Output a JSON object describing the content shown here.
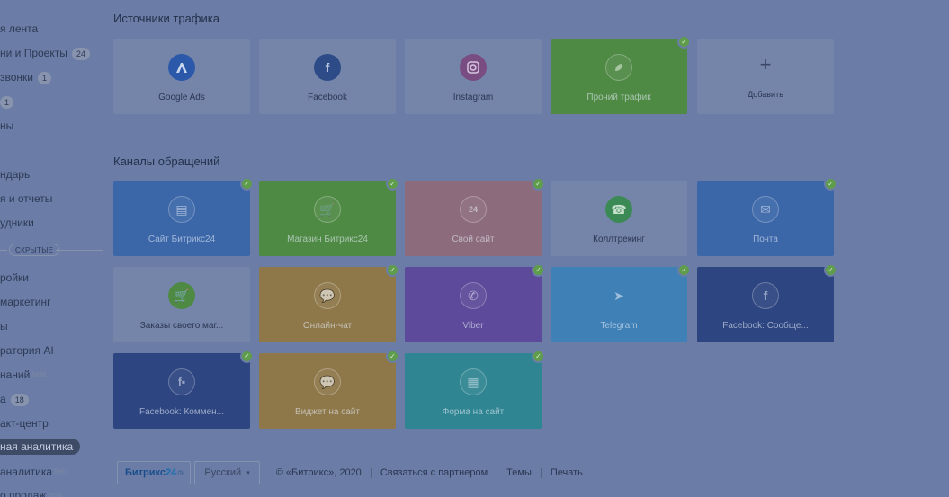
{
  "sidebar": {
    "items": [
      {
        "label": "я лента"
      },
      {
        "label": "ни и Проекты",
        "count": "24"
      },
      {
        "label": "звонки",
        "count": "1"
      },
      {
        "label": "",
        "count": "1"
      },
      {
        "label": "ны"
      },
      {
        "label": "ндарь"
      },
      {
        "label": "я и отчеты"
      },
      {
        "label": "удники"
      },
      {
        "label": "ройки"
      },
      {
        "label": "маркетинг"
      },
      {
        "label": "ы"
      },
      {
        "label": "ратория AI"
      },
      {
        "label": "наний"
      },
      {
        "label": "а",
        "count": "18"
      },
      {
        "label": "акт-центр"
      },
      {
        "label": "ная аналитика"
      },
      {
        "label": "аналитика"
      },
      {
        "label": "о продаж"
      }
    ],
    "hidden_label": "СКРЫТЫЕ",
    "beta": "beta"
  },
  "traffic": {
    "title": "Источники трафика",
    "tiles": [
      {
        "label": "Google Ads",
        "icon": "google-ads-icon"
      },
      {
        "label": "Facebook",
        "icon": "facebook-icon"
      },
      {
        "label": "Instagram",
        "icon": "instagram-icon"
      },
      {
        "label": "Прочий трафик",
        "icon": "leaf-icon"
      },
      {
        "label": "Добавить",
        "icon": "plus-icon"
      }
    ]
  },
  "channels": {
    "title": "Каналы обращений",
    "tiles": [
      {
        "label": "Сайт Битрикс24",
        "icon": "site-icon"
      },
      {
        "label": "Магазин Битрикс24",
        "icon": "cart-icon"
      },
      {
        "label": "Свой сайт",
        "icon": "calendar-24-icon"
      },
      {
        "label": "Коллтрекинг",
        "icon": "phone-refresh-icon"
      },
      {
        "label": "Почта",
        "icon": "mail-icon"
      },
      {
        "label": "Заказы своего маг...",
        "icon": "cart-icon"
      },
      {
        "label": "Онлайн-чат",
        "icon": "chat-icon"
      },
      {
        "label": "Viber",
        "icon": "viber-icon"
      },
      {
        "label": "Telegram",
        "icon": "telegram-icon"
      },
      {
        "label": "Facebook: Сообще...",
        "icon": "facebook-icon"
      },
      {
        "label": "Facebook: Коммен...",
        "icon": "facebook-comments-icon"
      },
      {
        "label": "Виджет на сайт",
        "icon": "chat-icon"
      },
      {
        "label": "Форма на сайт",
        "icon": "form-icon"
      }
    ]
  },
  "footer": {
    "logo": "Битрикс",
    "logo_num": "24",
    "language": "Русский",
    "copyright": "© «Битрикс», 2020",
    "partner_link": "Связаться с партнером",
    "themes_link": "Темы",
    "print_link": "Печать"
  },
  "colors": {
    "overlay_bg": "#6b7da6",
    "check": "#5f9c4c"
  }
}
